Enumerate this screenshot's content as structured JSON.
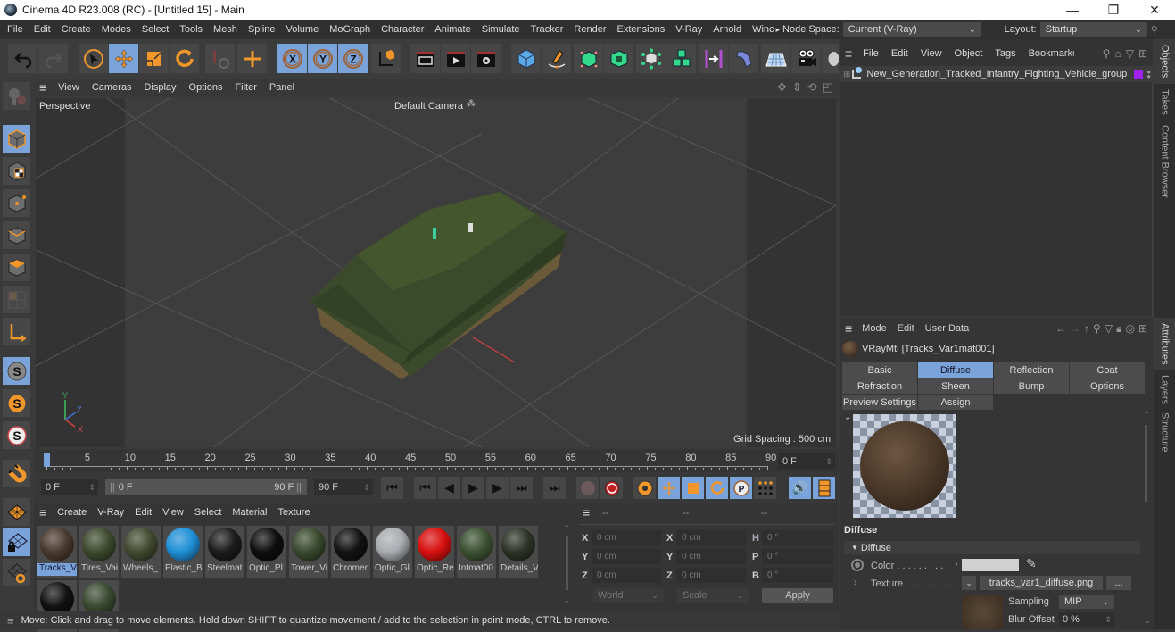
{
  "window": {
    "title": "Cinema 4D R23.008 (RC) - [Untitled 15] - Main",
    "controls": {
      "minimize": "—",
      "maximize": "❐",
      "close": "✕"
    }
  },
  "menubar": {
    "items": [
      "File",
      "Edit",
      "Create",
      "Modes",
      "Select",
      "Tools",
      "Mesh",
      "Spline",
      "Volume",
      "MoGraph",
      "Character",
      "Animate",
      "Simulate",
      "Tracker",
      "Render",
      "Extensions",
      "V-Ray",
      "Arnold",
      "Winc"
    ],
    "overflow_icon": "▸",
    "node_space_label": "Node Space:",
    "node_space_value": "Current (V-Ray)",
    "layout_label": "Layout:",
    "layout_value": "Startup"
  },
  "toolbar": {
    "tools": [
      "undo",
      "redo",
      "live-selection",
      "move",
      "scale",
      "rotate",
      "recent-tools",
      "add-tool",
      "x-axis",
      "y-axis",
      "z-axis",
      "coordinate-system",
      "render-view",
      "render-picture-viewer",
      "render-settings",
      "cube",
      "pen",
      "subdivision",
      "extrude",
      "cloner",
      "array",
      "symmetry",
      "deformer",
      "floor",
      "camera",
      "light"
    ],
    "axis_labels": {
      "x": "X",
      "y": "Y",
      "z": "Z"
    }
  },
  "viewport": {
    "menu": [
      "View",
      "Cameras",
      "Display",
      "Options",
      "Filter",
      "Panel"
    ],
    "view_name": "Perspective",
    "camera_name": "Default Camera",
    "grid_spacing": "Grid Spacing : 500 cm",
    "axis_labels": {
      "x": "X",
      "y": "Y",
      "z": "Z"
    }
  },
  "timeline": {
    "ticks": [
      "0",
      "5",
      "10",
      "15",
      "20",
      "25",
      "30",
      "35",
      "40",
      "45",
      "50",
      "55",
      "60",
      "65",
      "70",
      "75",
      "80",
      "85",
      "90"
    ],
    "current_frame_field": "0 F",
    "start_field": "0 F",
    "range_start": "0 F",
    "range_end": "90 F",
    "end_field": "90 F",
    "playhead_frame": 0,
    "max_frame": 90
  },
  "material_manager": {
    "menu": [
      "Create",
      "V-Ray",
      "Edit",
      "View",
      "Select",
      "Material",
      "Texture"
    ],
    "materials": [
      {
        "label": "Tracks_V",
        "color": "#4a3a2e",
        "selected": true
      },
      {
        "label": "Tires_Vai",
        "color": "#3e4a2e"
      },
      {
        "label": "Wheels_",
        "color": "#424a30"
      },
      {
        "label": "Plastic_B",
        "color": "#1f8fd6"
      },
      {
        "label": "Steelmat",
        "color": "#1c1c1c"
      },
      {
        "label": "Optic_Pl",
        "color": "#0e0e0e"
      },
      {
        "label": "Tower_Vi",
        "color": "#3a4a2e"
      },
      {
        "label": "Chromer",
        "color": "#121212"
      },
      {
        "label": "Optic_Gl",
        "color": "#a8acb0"
      },
      {
        "label": "Optic_Re",
        "color": "#d81010"
      },
      {
        "label": "Intmat00",
        "color": "#3c5232"
      },
      {
        "label": "Details_V",
        "color": "#2e3428"
      },
      {
        "label": "",
        "color": "#111111"
      },
      {
        "label": "",
        "color": "#3a4a30"
      }
    ]
  },
  "coordinates": {
    "headers": [
      "--",
      "--",
      "--"
    ],
    "position": {
      "x": "0 cm",
      "y": "0 cm",
      "z": "0 cm"
    },
    "size": {
      "x": "0 cm",
      "y": "0 cm",
      "z": "0 cm"
    },
    "rotation": {
      "h": "0 °",
      "p": "0 °",
      "b": "0 °"
    },
    "labels": {
      "x": "X",
      "y": "Y",
      "z": "Z",
      "h": "H",
      "p": "P",
      "b": "B"
    },
    "space_dropdown": "World",
    "mode_dropdown": "Scale",
    "apply_label": "Apply"
  },
  "object_manager": {
    "menu": [
      "File",
      "Edit",
      "View",
      "Object",
      "Tags",
      "Bookmarks"
    ],
    "objects": [
      {
        "name": "New_Generation_Tracked_Infantry_Fighting_Vehicle_group",
        "layer_color": "#a020f0"
      }
    ]
  },
  "attribute_manager": {
    "menu": [
      "Mode",
      "Edit",
      "User Data"
    ],
    "material_title": "VRayMtl [Tracks_Var1mat001]",
    "tabs": [
      {
        "label": "Basic"
      },
      {
        "label": "Diffuse",
        "active": true
      },
      {
        "label": "Reflection"
      },
      {
        "label": "Coat"
      },
      {
        "label": "Refraction"
      },
      {
        "label": "Sheen"
      },
      {
        "label": "Bump"
      },
      {
        "label": "Options"
      },
      {
        "label": "Preview Settings"
      },
      {
        "label": "Assign"
      }
    ],
    "section_title": "Diffuse",
    "group_title": "Diffuse",
    "color_label": "Color . . . . . . . . .",
    "color_value": "#d0d0d0",
    "texture_label": "Texture . . . . . . . . .",
    "texture_file": "tracks_var1_diffuse.png",
    "texture_more": "...",
    "sampling_label": "Sampling",
    "sampling_value": "MIP",
    "blur_offset_label": "Blur Offset",
    "blur_offset_value": "0 %"
  },
  "side_tabs": {
    "top": [
      "Objects",
      "Takes",
      "Content Browser"
    ],
    "bottom": [
      "Attributes",
      "Layers",
      "Structure"
    ]
  },
  "statusbar": {
    "message": "Move: Click and drag to move elements. Hold down SHIFT to quantize movement / add to the selection in point mode, CTRL to remove."
  },
  "colors": {
    "accent": "#7aa3d9",
    "orange": "#f0962a",
    "panel": "#353535"
  }
}
